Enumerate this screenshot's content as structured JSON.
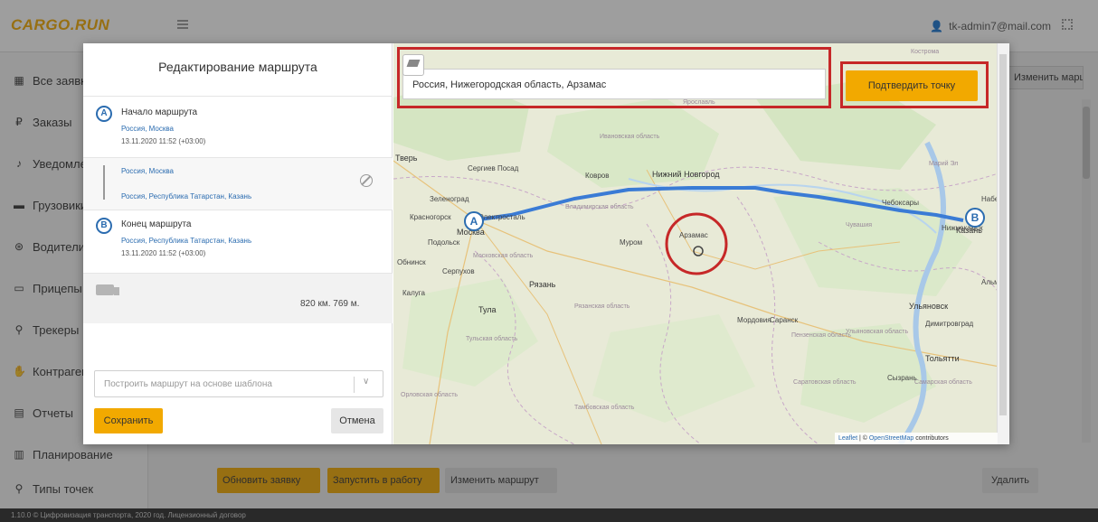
{
  "app": {
    "logo": "CARGO.RUN",
    "user_email": "tk-admin7@mail.com"
  },
  "sidebar": {
    "items": [
      {
        "label": "Все заявки",
        "icon": "clipboard-icon"
      },
      {
        "label": "Заказы",
        "icon": "ruble-icon"
      },
      {
        "label": "Уведомления",
        "icon": "bell-icon"
      },
      {
        "label": "Грузовики",
        "icon": "truck-icon"
      },
      {
        "label": "Водители",
        "icon": "steering-wheel-icon"
      },
      {
        "label": "Прицепы",
        "icon": "trailer-icon"
      },
      {
        "label": "Трекеры",
        "icon": "map-pin-icon"
      },
      {
        "label": "Контрагенты",
        "icon": "handshake-icon"
      },
      {
        "label": "Отчеты",
        "icon": "report-icon"
      },
      {
        "label": "Планирование",
        "icon": "calendar-icon"
      },
      {
        "label": "Типы точек",
        "icon": "map-pin-icon"
      }
    ]
  },
  "background": {
    "top_right_button": "Изменить маршрут",
    "buttons": {
      "update": "Обновить заявку",
      "start": "Запустить в работу",
      "change_route": "Изменить маршрут",
      "delete": "Удалить"
    }
  },
  "footer": {
    "text": "1.10.0 © Цифровизация транспорта, 2020 год. Лицензионный договор"
  },
  "modal": {
    "title": "Редактирование маршрута",
    "point_a": {
      "marker": "A",
      "label": "Начало маршрута",
      "place": "Россия, Москва",
      "time": "13.11.2020 11:52 (+03:00)"
    },
    "segment": {
      "from": "Россия, Москва",
      "to": "Россия, Республика Татарстан, Казань"
    },
    "point_b": {
      "marker": "B",
      "label": "Конец маршрута",
      "place": "Россия, Республика Татарстан, Казань",
      "time": "13.11.2020 11:52 (+03:00)"
    },
    "distance": "820 км. 769 м.",
    "template_placeholder": "Построить маршрут на основе шаблона",
    "template_arrow": "∨",
    "save_label": "Сохранить",
    "cancel_label": "Отмена"
  },
  "map": {
    "search_value": "Россия, Нижегородская область, Арзамас",
    "confirm_label": "Подтвердить точку",
    "attribution": {
      "leaflet": "Leaflet",
      "separator": " | © ",
      "osm": "OpenStreetMap",
      "suffix": " contributors"
    },
    "marker_a": "A",
    "marker_b": "B",
    "labels": {
      "tver": "Тверь",
      "sergiev_posad": "Сергиев Посад",
      "kovrov": "Ковров",
      "nizhny": "Нижний Новгород",
      "zelenograd": "Зеленоград",
      "krasnogorsk": "Красногорск",
      "elektrostal": "Электросталь",
      "moscow": "Москва",
      "podolsk": "Подольск",
      "obninsk": "Обнинск",
      "serpukhov": "Серпухов",
      "murom": "Муром",
      "arzamas": "Арзамас",
      "ryazan": "Рязань",
      "kaluga": "Калуга",
      "tula": "Тула",
      "mordovia": "Мордовия",
      "saransk": "Саранск",
      "ulyanovsk": "Ульяновск",
      "dimitrovgrad": "Димитровград",
      "tolyatti": "Тольятти",
      "syzran": "Сызрань",
      "kazan": "Казань",
      "cheboksary": "Чебоксары",
      "chuvashia": "Чувашия",
      "nizhnekamsk": "Нижнекамск",
      "yaroslavl": "Ярославль",
      "kostroma": "Кострома",
      "mariy_el": "Марий Эл",
      "vladimir_obl": "Владимирская область",
      "moscow_obl": "Московская область",
      "ryazan_obl": "Рязанская область",
      "tula_obl": "Тульская область",
      "penza_obl": "Пензенская область",
      "tambov_obl": "Тамбовская область",
      "orel_obl": "Орловская область",
      "ulyanovsk_obl": "Ульяновская область",
      "samara_obl": "Самарская область",
      "saratov_obl": "Саратовская область",
      "ivanovo_obl": "Ивановская область",
      "naberezhnye": "Набе",
      "alm": "Альм"
    }
  }
}
